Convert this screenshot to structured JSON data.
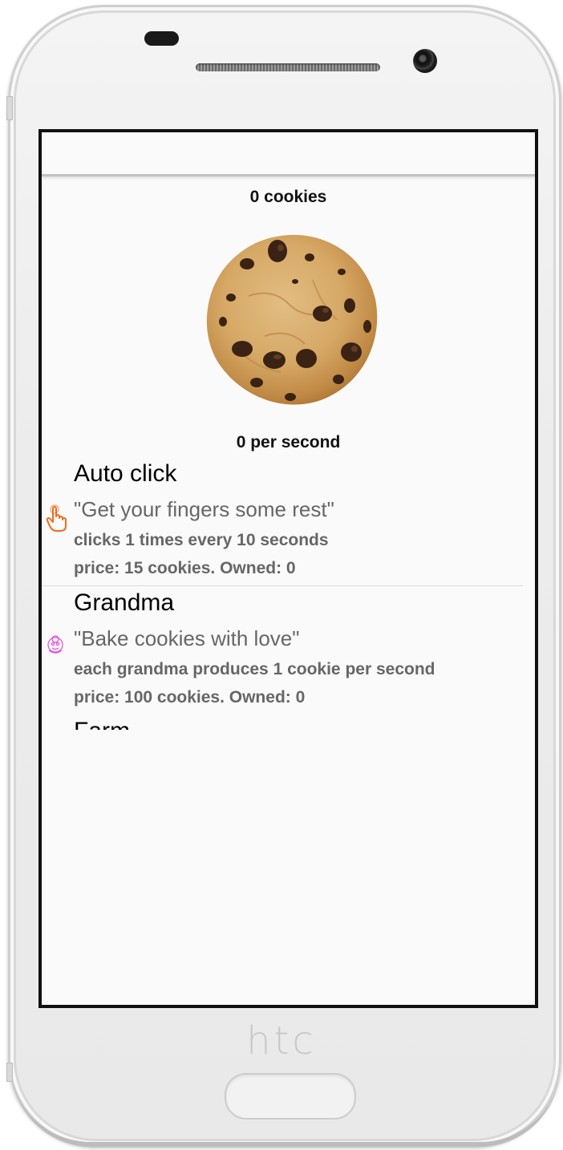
{
  "device": {
    "brand": "htc"
  },
  "game": {
    "cookie_count": "0 cookies",
    "per_second": "0 per second",
    "cookie_image": "chocolate-chip-cookie"
  },
  "upgrades": [
    {
      "name": "Auto click",
      "quote": "\"Get your fingers some rest\"",
      "description": "clicks 1 times every 10 seconds",
      "price": "price: 15 cookies. Owned: 0",
      "icon": "pointer-hand-icon",
      "icon_color": "#f26b1d"
    },
    {
      "name": "Grandma",
      "quote": "\"Bake cookies with love\"",
      "description": "each grandma produces 1 cookie per second",
      "price": "price: 100 cookies. Owned: 0",
      "icon": "grandma-icon",
      "icon_color": "#e04be0"
    },
    {
      "name": "Farm"
    }
  ]
}
